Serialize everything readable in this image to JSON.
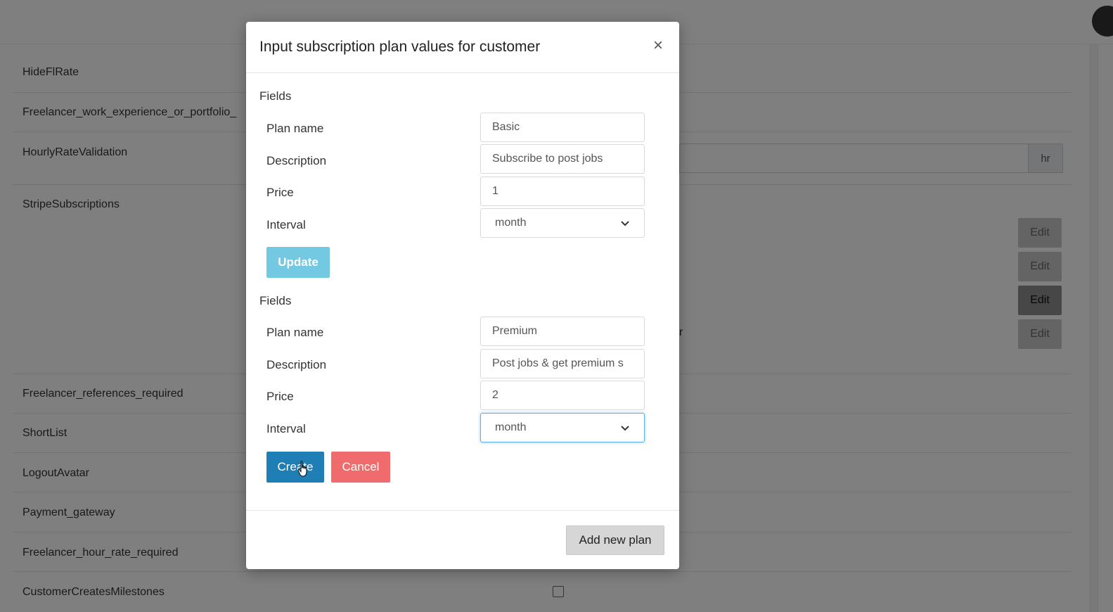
{
  "background": {
    "rows": [
      {
        "label": "HideFlRate"
      },
      {
        "label": "Freelancer_work_experience_or_portfolio_"
      },
      {
        "label": "HourlyRateValidation"
      },
      {
        "label": "StripeSubscriptions"
      },
      {
        "label": "Freelancer_references_required"
      },
      {
        "label": "ShortList"
      },
      {
        "label": "LogoutAvatar"
      },
      {
        "label": "Payment_gateway"
      },
      {
        "label": "Freelancer_hour_rate_required"
      },
      {
        "label": "CustomerCreatesMilestones"
      }
    ],
    "hourly_addon": "hr",
    "edit_labels": [
      "Edit",
      "Edit",
      "Edit",
      "Edit"
    ],
    "partial_text": "r"
  },
  "modal": {
    "title": "Input subscription plan values for customer",
    "close_glyph": "×",
    "plans": [
      {
        "section_label": "Fields",
        "plan_name_label": "Plan name",
        "plan_name_value": "Basic",
        "description_label": "Description",
        "description_value": "Subscribe to post jobs",
        "price_label": "Price",
        "price_value": "1",
        "interval_label": "Interval",
        "interval_value": "month",
        "primary_button": "Update"
      },
      {
        "section_label": "Fields",
        "plan_name_label": "Plan name",
        "plan_name_value": "Premium",
        "description_label": "Description",
        "description_value": "Post jobs & get premium s",
        "price_label": "Price",
        "price_value": "2",
        "interval_label": "Interval",
        "interval_value": "month",
        "primary_button": "Create",
        "secondary_button": "Cancel"
      }
    ],
    "footer_button": "Add new plan"
  },
  "colors": {
    "update": "#5bc0de",
    "create": "#1f7fb4",
    "cancel": "#f06c6c"
  }
}
